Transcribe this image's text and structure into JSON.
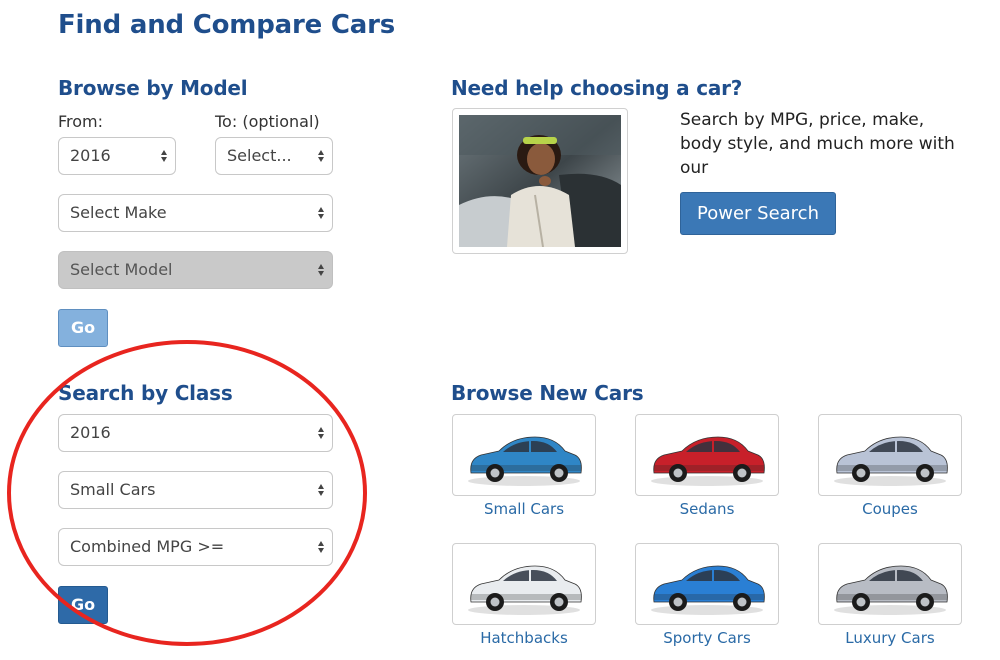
{
  "page": {
    "title": "Find and Compare Cars"
  },
  "browse_model": {
    "heading": "Browse by Model",
    "from_label": "From:",
    "to_label": "To: (optional)",
    "from_value": "2016",
    "to_value": "Select...",
    "make_value": "Select Make",
    "model_value": "Select Model",
    "go_label": "Go"
  },
  "search_class": {
    "heading": "Search by Class",
    "year_value": "2016",
    "class_value": "Small Cars",
    "mpg_value": "Combined MPG >=",
    "go_label": "Go"
  },
  "help": {
    "heading": "Need help choosing a car?",
    "description": "Search by MPG, price, make, body style, and much more with our",
    "button_label": "Power Search"
  },
  "browse_new": {
    "heading": "Browse New Cars",
    "categories": [
      {
        "label": "Small Cars",
        "car_color": "#2f86c6"
      },
      {
        "label": "Sedans",
        "car_color": "#c8202a"
      },
      {
        "label": "Coupes",
        "car_color": "#b9c3d6"
      },
      {
        "label": "Hatchbacks",
        "car_color": "#e9ecef"
      },
      {
        "label": "Sporty Cars",
        "car_color": "#2a7fd4"
      },
      {
        "label": "Luxury Cars",
        "car_color": "#b8bcc4"
      }
    ]
  },
  "colors": {
    "heading": "#1f4e8c",
    "link": "#2a6aa6",
    "button": "#3b78b6",
    "annotation": "#e8251f"
  }
}
